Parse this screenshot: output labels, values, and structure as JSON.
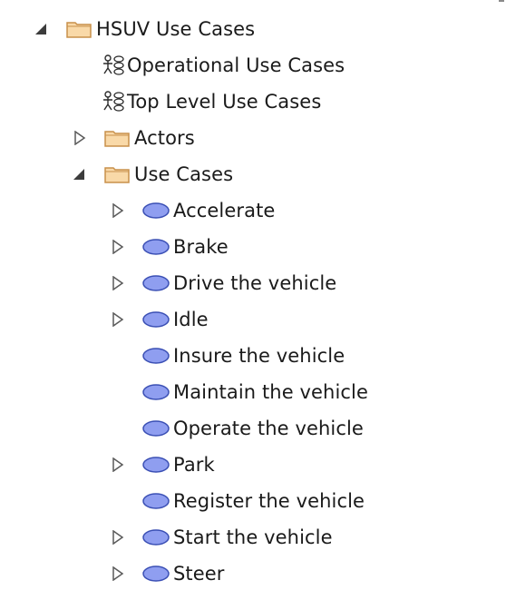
{
  "tree": {
    "root": {
      "label": "HSUV Use Cases",
      "icon": "folder-icon",
      "expanded": true
    },
    "diagrams": [
      {
        "label": "Operational Use Cases",
        "icon": "use-case-diagram-icon"
      },
      {
        "label": "Top Level Use Cases",
        "icon": "use-case-diagram-icon"
      }
    ],
    "folders": [
      {
        "label": "Actors",
        "icon": "folder-icon",
        "expanded": false
      },
      {
        "label": "Use Cases",
        "icon": "folder-icon",
        "expanded": true
      }
    ],
    "use_cases": [
      {
        "label": "Accelerate",
        "expandable": true
      },
      {
        "label": "Brake",
        "expandable": true
      },
      {
        "label": "Drive the vehicle",
        "expandable": true
      },
      {
        "label": "Idle",
        "expandable": true
      },
      {
        "label": "Insure the vehicle",
        "expandable": false
      },
      {
        "label": "Maintain the vehicle",
        "expandable": false
      },
      {
        "label": "Operate the vehicle",
        "expandable": false
      },
      {
        "label": "Park",
        "expandable": true
      },
      {
        "label": "Register the vehicle",
        "expandable": false
      },
      {
        "label": "Start the vehicle",
        "expandable": true
      },
      {
        "label": "Steer",
        "expandable": true
      }
    ],
    "colors": {
      "folder_fill": "#f9d9a8",
      "folder_stroke": "#c8904a",
      "use_case_fill": "#8f9ef0",
      "use_case_stroke": "#3a4fb4",
      "toggle_filled": "#3c3c3c",
      "toggle_outline": "#5a5a5a"
    }
  }
}
